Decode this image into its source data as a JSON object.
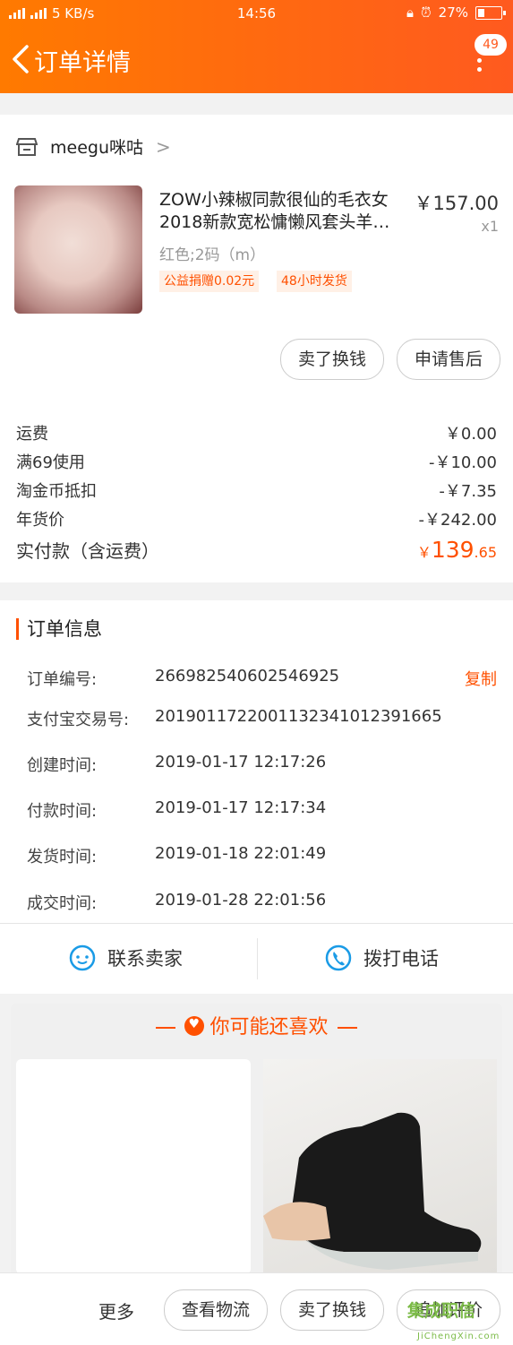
{
  "status_bar": {
    "network_speed": "5 KB/s",
    "time": "14:56",
    "battery": "27%"
  },
  "nav": {
    "title": "订单详情",
    "badge": "49"
  },
  "shop": {
    "name": "meegu咪咕"
  },
  "product": {
    "title": "ZOW小辣椒同款很仙的毛衣女2018新款宽松慵懒风套头羊…",
    "price": "￥157.00",
    "qty": "x1",
    "sku": "红色;2码（m）",
    "tags": [
      "公益捐赠0.02元",
      "48小时发货"
    ]
  },
  "product_actions": [
    "卖了换钱",
    "申请售后"
  ],
  "fees": [
    {
      "label": "运费",
      "value": "￥0.00"
    },
    {
      "label": "满69使用",
      "value": "-￥10.00"
    },
    {
      "label": "淘金币抵扣",
      "value": "-￥7.35"
    },
    {
      "label": "年货价",
      "value": "-￥242.00"
    }
  ],
  "paid": {
    "label": "实付款（含运费）",
    "currency": "￥",
    "int": "139",
    "dec": ".65"
  },
  "order_info": {
    "title": "订单信息",
    "copy_label": "复制",
    "rows": [
      {
        "k": "订单编号:",
        "v": "266982540602546925"
      },
      {
        "k": "支付宝交易号:",
        "v": "2019011722001132341012391665"
      },
      {
        "k": "创建时间:",
        "v": "2019-01-17 12:17:26"
      },
      {
        "k": "付款时间:",
        "v": "2019-01-17 12:17:34"
      },
      {
        "k": "发货时间:",
        "v": "2019-01-18 22:01:49"
      },
      {
        "k": "成交时间:",
        "v": "2019-01-28 22:01:56"
      }
    ]
  },
  "contact": {
    "seller": "联系卖家",
    "phone": "拨打电话"
  },
  "recommend": {
    "title": "你可能还喜欢"
  },
  "bottom": {
    "more": "更多",
    "buttons": [
      "查看物流",
      "卖了换钱",
      "追加评价"
    ]
  },
  "watermark": {
    "text": "集成职信",
    "url": "JiChengXin.com"
  },
  "colors": {
    "accent": "#ff5000",
    "nav_start": "#ff7a00",
    "nav_end": "#ff5a1f"
  }
}
